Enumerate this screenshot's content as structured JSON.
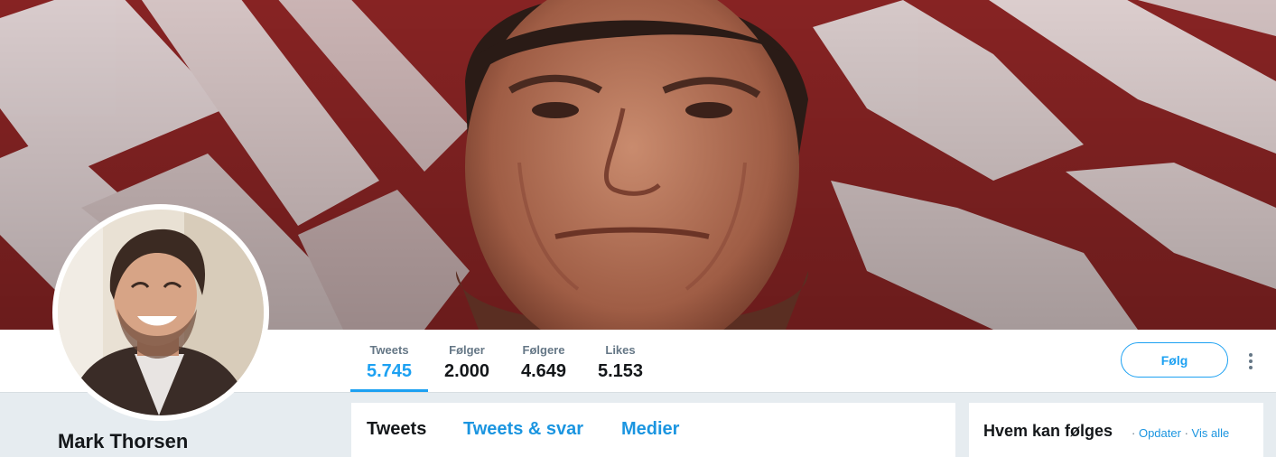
{
  "profile": {
    "name": "Mark Thorsen"
  },
  "stats": [
    {
      "label": "Tweets",
      "value": "5.745",
      "active": true
    },
    {
      "label": "Følger",
      "value": "2.000",
      "active": false
    },
    {
      "label": "Følgere",
      "value": "4.649",
      "active": false
    },
    {
      "label": "Likes",
      "value": "5.153",
      "active": false
    }
  ],
  "actions": {
    "follow_label": "Følg",
    "more_icon": "vertical-ellipsis-icon"
  },
  "timeline_tabs": [
    {
      "label": "Tweets",
      "active": true
    },
    {
      "label": "Tweets & svar",
      "active": false
    },
    {
      "label": "Medier",
      "active": false
    }
  ],
  "who_to_follow": {
    "title": "Hvem kan følges",
    "separator": "·",
    "refresh_label": "Opdater",
    "view_all_label": "Vis alle"
  },
  "colors": {
    "accent": "#1da1f2",
    "link": "#1b95e0",
    "background": "#e6ecf0",
    "muted": "#657786"
  }
}
